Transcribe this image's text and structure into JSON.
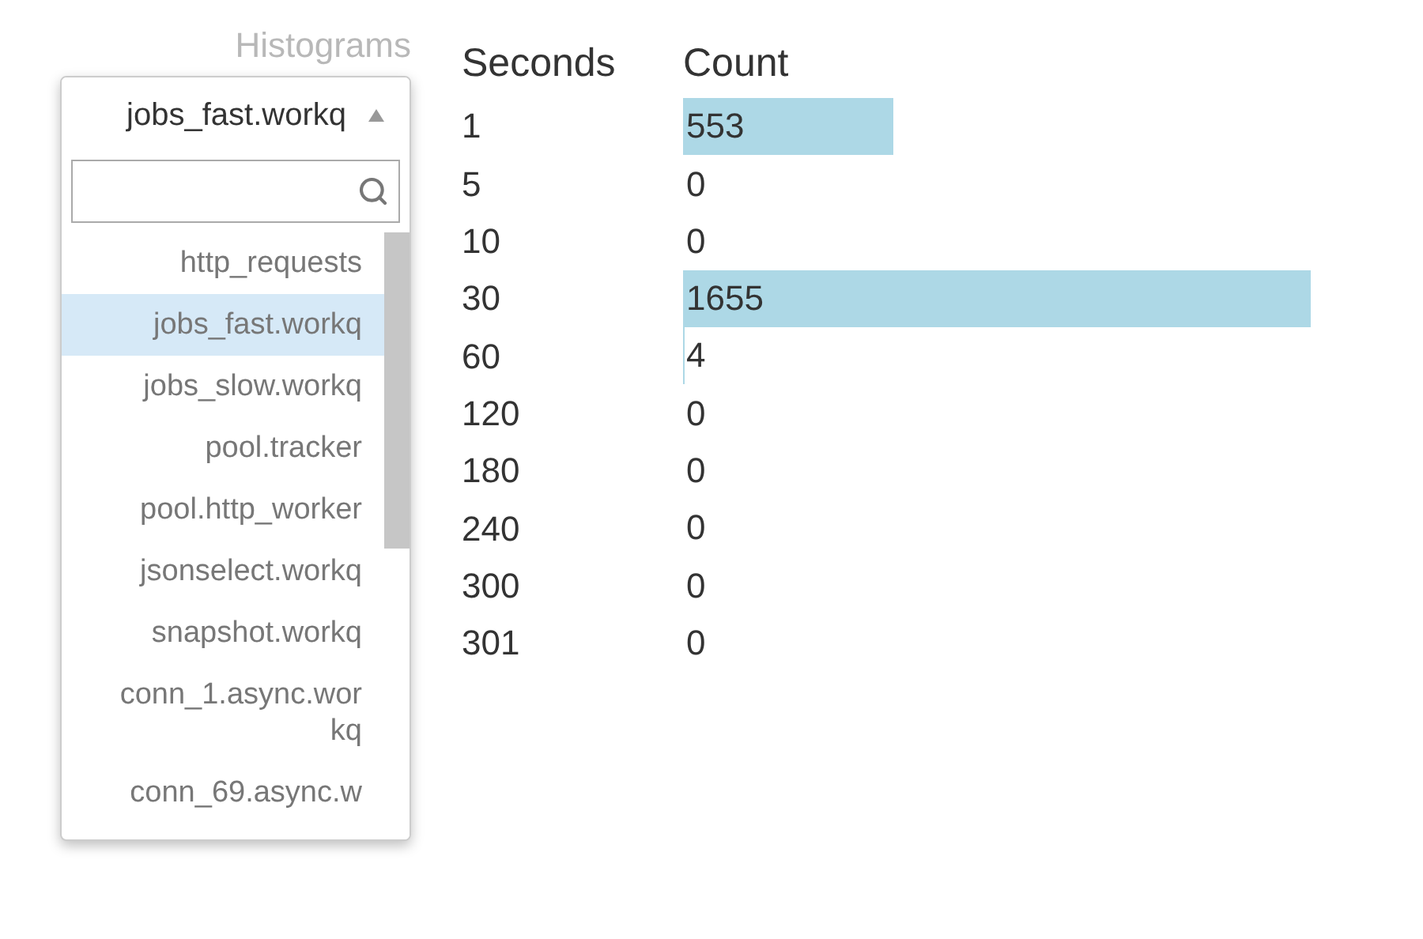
{
  "histograms_label": "Histograms",
  "dropdown": {
    "value": "jobs_fast.workq",
    "expanded": true,
    "items": [
      {
        "label": "http_requests",
        "selected": false
      },
      {
        "label": "jobs_fast.workq",
        "selected": true
      },
      {
        "label": "jobs_slow.workq",
        "selected": false
      },
      {
        "label": "pool.tracker",
        "selected": false
      },
      {
        "label": "pool.http_worker",
        "selected": false
      },
      {
        "label": "jsonselect.workq",
        "selected": false
      },
      {
        "label": "snapshot.workq",
        "selected": false
      },
      {
        "label": "conn_1.async.workq",
        "selected": false
      },
      {
        "label": "conn_69.async.w",
        "selected": false
      }
    ]
  },
  "table": {
    "columns": [
      "Seconds",
      "Count"
    ],
    "rows": [
      {
        "seconds": "1",
        "count": "553"
      },
      {
        "seconds": "5",
        "count": "0"
      },
      {
        "seconds": "10",
        "count": "0"
      },
      {
        "seconds": "30",
        "count": "1655"
      },
      {
        "seconds": "60",
        "count": "4"
      },
      {
        "seconds": "120",
        "count": "0"
      },
      {
        "seconds": "180",
        "count": "0"
      },
      {
        "seconds": "240",
        "count": "0"
      },
      {
        "seconds": "300",
        "count": "0"
      },
      {
        "seconds": "301",
        "count": "0"
      }
    ]
  }
}
